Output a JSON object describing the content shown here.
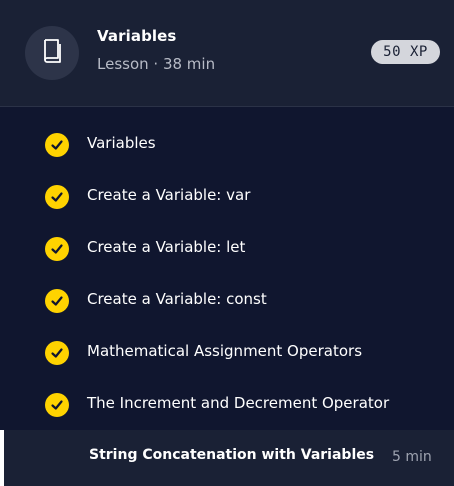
{
  "lesson": {
    "title": "Variables",
    "meta": "Lesson · 38 min",
    "xp": "50 XP",
    "icon": "book-icon"
  },
  "items": [
    {
      "label": "Variables",
      "completed": true
    },
    {
      "label": "Create a Variable: var",
      "completed": true
    },
    {
      "label": "Create a Variable: let",
      "completed": true
    },
    {
      "label": "Create a Variable: const",
      "completed": true
    },
    {
      "label": "Mathematical Assignment Operators",
      "completed": true
    },
    {
      "label": "The Increment and Decrement Operator",
      "completed": true
    }
  ],
  "current": {
    "label": "String Concatenation with Variables",
    "duration": "5 min"
  },
  "colors": {
    "header_bg": "#1a2135",
    "list_bg": "#10162f",
    "check": "#ffd300",
    "badge_bg": "#d4d6dc"
  }
}
